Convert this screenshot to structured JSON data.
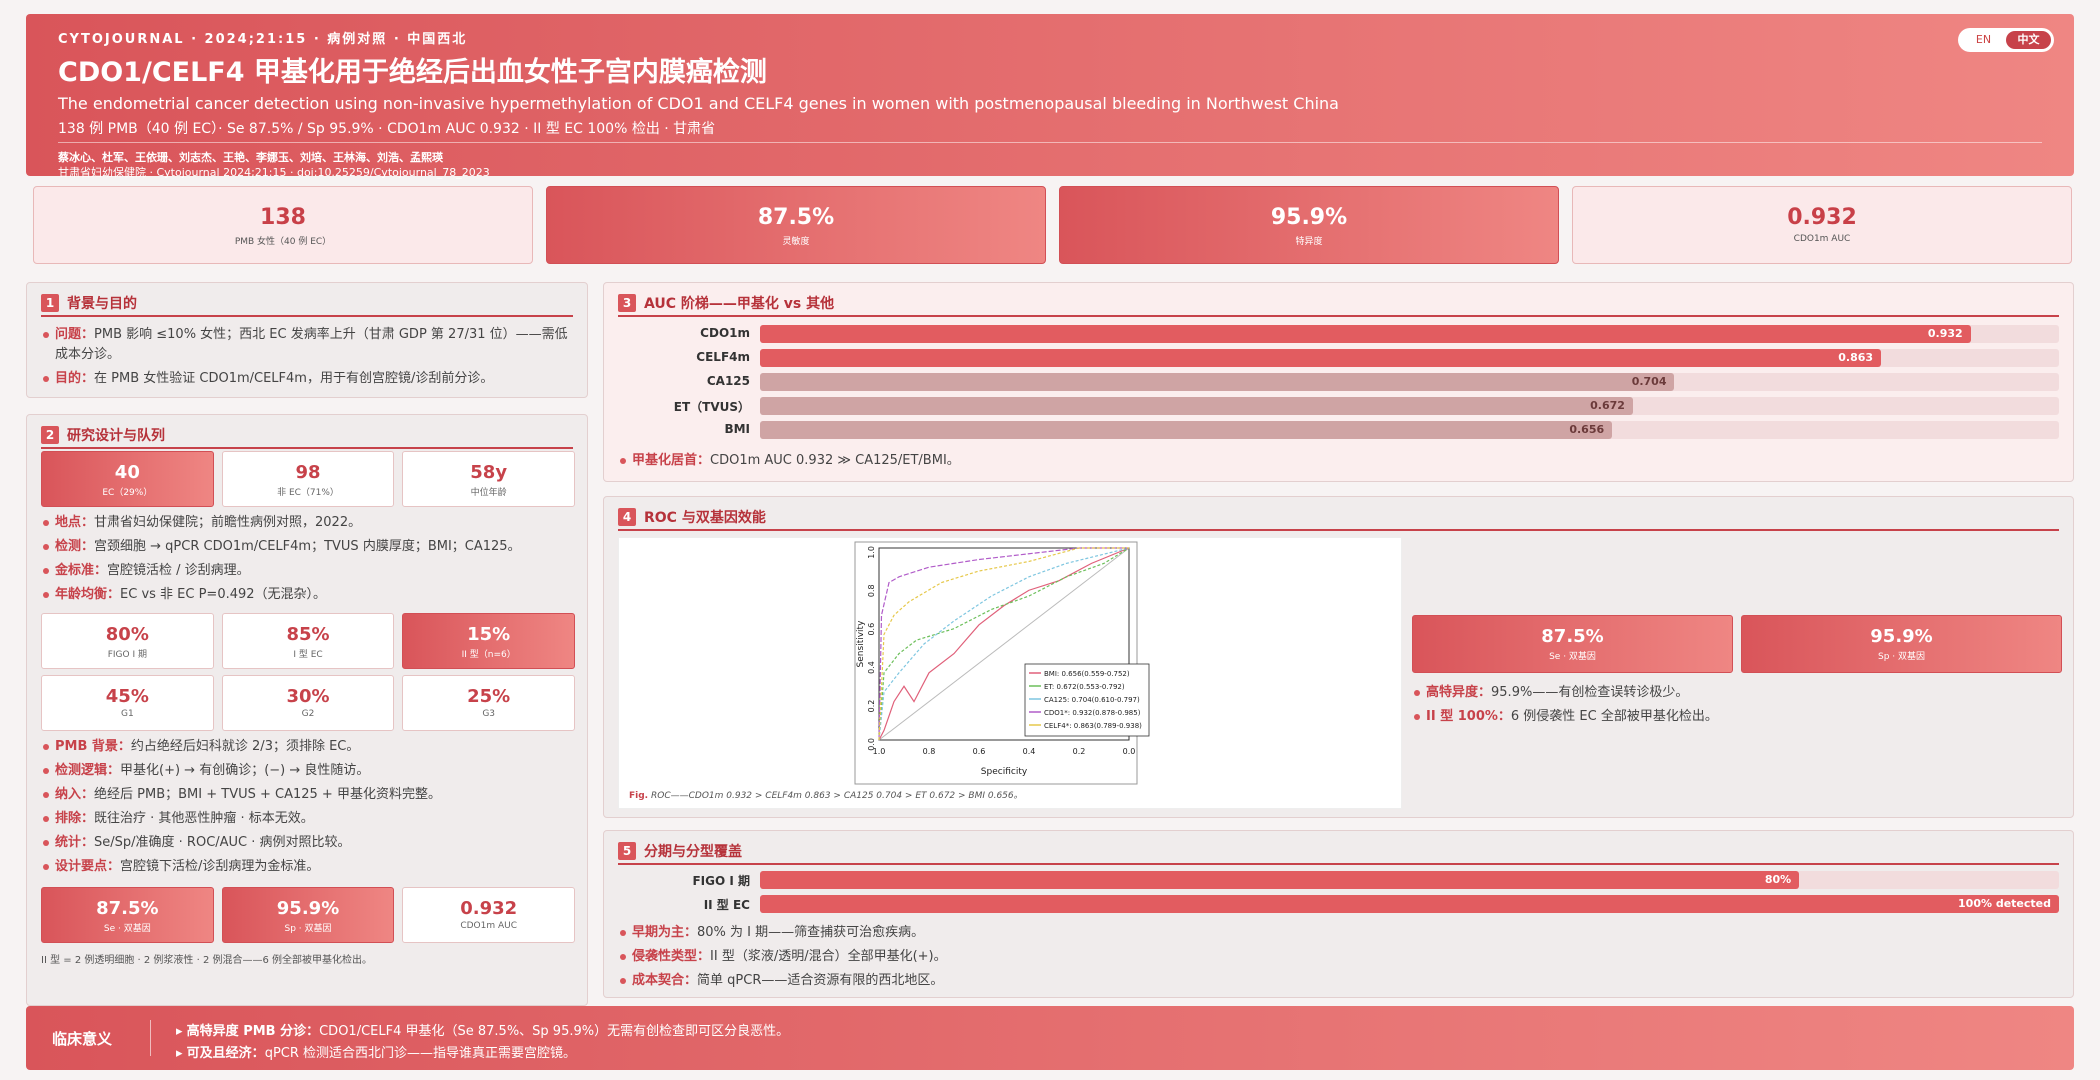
{
  "header": {
    "meta": "CYTOJOURNAL · 2024;21:15 · 病例对照 · 中国西北",
    "title": "CDO1/CELF4 甲基化用于绝经后出血女性子宫内膜癌检测",
    "subtitle": "The endometrial cancer detection using non-invasive hypermethylation of CDO1 and CELF4 genes in women with postmenopausal bleeding in Northwest China",
    "summary": "138 例 PMB（40 例 EC）· Se 87.5% / Sp 95.9% · CDO1m AUC 0.932 · II 型 EC 100% 检出 · 甘肃省",
    "authors": "蔡冰心、杜军、王依珊、刘志杰、王艳、李娜玉、刘培、王林海、刘浩、孟熙瑛",
    "affiliation": "甘肃省妇幼保健院 · Cytojournal 2024;21:15 · doi:10.25259/Cytojournal_78_2023",
    "lang_en": "EN",
    "lang_zh": "中文"
  },
  "stats": [
    {
      "value": "138",
      "label": "PMB 女性（40 例 EC）"
    },
    {
      "value": "87.5%",
      "label": "灵敏度"
    },
    {
      "value": "95.9%",
      "label": "特异度"
    },
    {
      "value": "0.932",
      "label": "CDO1m AUC"
    }
  ],
  "s1": {
    "num": "1",
    "title": "背景与目的",
    "items": [
      {
        "k": "问题：",
        "t": "PMB 影响 ≤10% 女性；西北 EC 发病率上升（甘肃 GDP 第 27/31 位）——需低成本分诊。"
      },
      {
        "k": "目的：",
        "t": "在 PMB 女性验证 CDO1m/CELF4m，用于有创宫腔镜/诊刮前分诊。"
      }
    ]
  },
  "s2": {
    "num": "2",
    "title": "研究设计与队列",
    "row1": [
      {
        "v": "40",
        "l": "EC（29%）"
      },
      {
        "v": "98",
        "l": "非 EC（71%）"
      },
      {
        "v": "58y",
        "l": "中位年龄"
      }
    ],
    "items1": [
      {
        "k": "地点：",
        "t": "甘肃省妇幼保健院；前瞻性病例对照，2022。"
      },
      {
        "k": "检测：",
        "t": "宫颈细胞 → qPCR CDO1m/CELF4m；TVUS 内膜厚度；BMI；CA125。"
      },
      {
        "k": "金标准：",
        "t": "宫腔镜活检 / 诊刮病理。"
      },
      {
        "k": "年龄均衡：",
        "t": "EC vs 非 EC P=0.492（无混杂）。"
      }
    ],
    "row2": [
      {
        "v": "80%",
        "l": "FIGO I 期"
      },
      {
        "v": "85%",
        "l": "I 型 EC"
      },
      {
        "v": "15%",
        "l": "II 型（n=6）"
      }
    ],
    "row3": [
      {
        "v": "45%",
        "l": "G1"
      },
      {
        "v": "30%",
        "l": "G2"
      },
      {
        "v": "25%",
        "l": "G3"
      }
    ],
    "items2": [
      {
        "k": "PMB 背景：",
        "t": "约占绝经后妇科就诊 2/3；须排除 EC。"
      },
      {
        "k": "检测逻辑：",
        "t": "甲基化(+) → 有创确诊；(−) → 良性随访。"
      },
      {
        "k": "纳入：",
        "t": "绝经后 PMB；BMI + TVUS + CA125 + 甲基化资料完整。"
      },
      {
        "k": "排除：",
        "t": "既往治疗 · 其他恶性肿瘤 · 标本无效。"
      },
      {
        "k": "统计：",
        "t": "Se/Sp/准确度 · ROC/AUC · 病例对照比较。"
      },
      {
        "k": "设计要点：",
        "t": "宫腔镜下活检/诊刮病理为金标准。"
      }
    ],
    "row4": [
      {
        "v": "87.5%",
        "l": "Se · 双基因"
      },
      {
        "v": "95.9%",
        "l": "Sp · 双基因"
      },
      {
        "v": "0.932",
        "l": "CDO1m AUC"
      }
    ],
    "note": "II 型 = 2 例透明细胞 · 2 例浆液性 · 2 例混合——6 例全部被甲基化检出。"
  },
  "s3": {
    "num": "3",
    "title": "AUC 阶梯——甲基化 vs 其他",
    "bars": [
      {
        "name": "CDO1m",
        "value": 0.932,
        "label": "0.932"
      },
      {
        "name": "CELF4m",
        "value": 0.863,
        "label": "0.863"
      },
      {
        "name": "CA125",
        "value": 0.704,
        "label": "0.704"
      },
      {
        "name": "ET（TVUS）",
        "value": 0.672,
        "label": "0.672"
      },
      {
        "name": "BMI",
        "value": 0.656,
        "label": "0.656"
      }
    ],
    "note_k": "甲基化居首：",
    "note_t": "CDO1m AUC 0.932 ≫ CA125/ET/BMI。"
  },
  "s4": {
    "num": "4",
    "title": "ROC 与双基因效能",
    "tiles": [
      {
        "v": "87.5%",
        "l": "Se · 双基因"
      },
      {
        "v": "95.9%",
        "l": "Sp · 双基因"
      }
    ],
    "items": [
      {
        "k": "高特异度：",
        "t": "95.9%——有创检查误转诊极少。"
      },
      {
        "k": "II 型 100%：",
        "t": "6 例侵袭性 EC 全部被甲基化检出。"
      }
    ],
    "caption_k": "Fig.",
    "caption_t": "ROC——CDO1m 0.932 > CELF4m 0.863 > CA125 0.704 > ET 0.672 > BMI 0.656。",
    "roc": {
      "ylabel": "Sensitivity",
      "xlabel": "Specificity",
      "yticks": [
        "0.0",
        "0.2",
        "0.4",
        "0.6",
        "0.8",
        "1.0"
      ],
      "xticks": [
        "1.0",
        "0.8",
        "0.6",
        "0.4",
        "0.2",
        "0.0"
      ],
      "legend": [
        {
          "t": "BMI: 0.656(0.559-0.752)",
          "c": "#e0607a"
        },
        {
          "t": "ET: 0.672(0.553-0.792)",
          "c": "#6cbf5a"
        },
        {
          "t": "CA125: 0.704(0.610-0.797)",
          "c": "#7ec6e0"
        },
        {
          "t": "CDO1*: 0.932(0.878-0.985)",
          "c": "#b15cc9"
        },
        {
          "t": "CELF4*: 0.863(0.789-0.938)",
          "c": "#e6c84a"
        }
      ]
    }
  },
  "s5": {
    "num": "5",
    "title": "分期与分型覆盖",
    "bars": [
      {
        "name": "FIGO I 期",
        "value": 0.8,
        "label": "80%"
      },
      {
        "name": "II 型 EC",
        "value": 1.0,
        "label": "100% detected"
      }
    ],
    "items": [
      {
        "k": "早期为主：",
        "t": "80% 为 I 期——筛查捕获可治愈疾病。"
      },
      {
        "k": "侵袭性类型：",
        "t": "II 型（浆液/透明/混合）全部甲基化(+)。"
      },
      {
        "k": "成本契合：",
        "t": "简单 qPCR——适合资源有限的西北地区。"
      }
    ]
  },
  "footer": {
    "key": "临床意义",
    "l1k": "高特异度 PMB 分诊：",
    "l1t": "CDO1/CELF4 甲基化（Se 87.5%、Sp 95.9%）无需有创检查即可区分良恶性。",
    "l2k": "可及且经济：",
    "l2t": "qPCR 检测适合西北门诊——指导谁真正需要宫腔镜。"
  },
  "colors": {
    "accent": "#d9555a",
    "accent_dark": "#c7424a"
  }
}
